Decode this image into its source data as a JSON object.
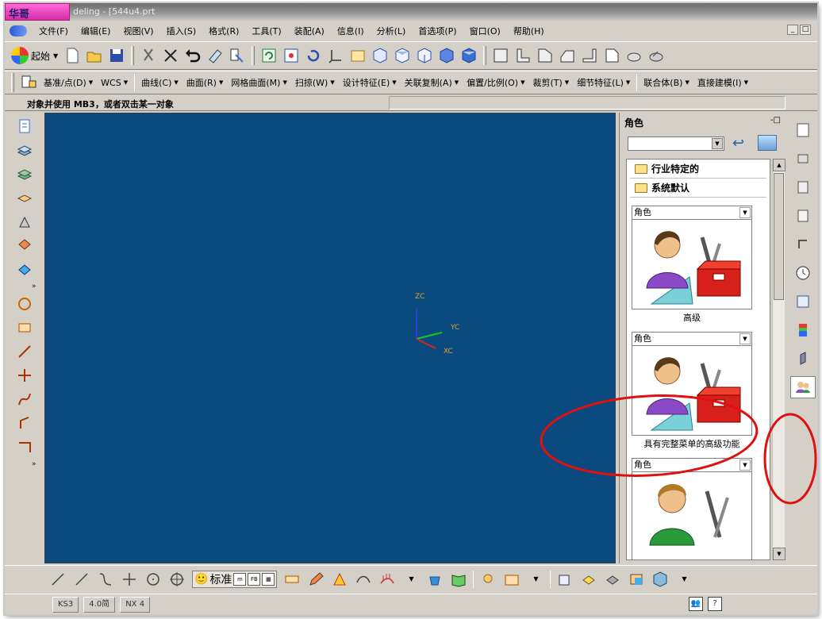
{
  "window": {
    "badge": "华哥",
    "title": "deling - [544u4.prt"
  },
  "menu": [
    "文件(F)",
    "编辑(E)",
    "视图(V)",
    "插入(S)",
    "格式(R)",
    "工具(T)",
    "装配(A)",
    "信息(I)",
    "分析(L)",
    "首选项(P)",
    "窗口(O)",
    "帮助(H)"
  ],
  "toolbar1": {
    "start_label": "起始",
    "icons": [
      "new-file-icon",
      "open-folder-icon",
      "save-icon",
      "cut-icon",
      "delete-icon",
      "undo-icon",
      "eraser-icon",
      "info-icon",
      "refresh-icon",
      "fit-icon",
      "rotate-icon",
      "wcs-icon",
      "shaded-icon",
      "isometric-view-icon",
      "top-view-icon",
      "front-view-icon",
      "right-view-icon",
      "shaded-box-icon",
      "face-select-icon",
      "l-select-icon",
      "plane-select-icon",
      "slope-select-icon",
      "step-select-icon",
      "sheet-select-icon",
      "part-nav-icon",
      "assembly-nav-icon"
    ]
  },
  "toolbar2": {
    "menus": [
      "基准/点(D)",
      "WCS",
      "曲线(C)",
      "曲面(R)",
      "网格曲面(M)",
      "扫掠(W)",
      "设计特征(E)",
      "关联复制(A)",
      "偏置/比例(O)",
      "裁剪(T)",
      "细节特征(L)",
      "联合体(B)",
      "直接建模(I)"
    ]
  },
  "status": {
    "message": "对象并使用 MB3，或者双击某一对象"
  },
  "viewport": {
    "bg": "#0b4a7e",
    "axes": {
      "zc": "ZC",
      "yc": "YC",
      "xc": "XC"
    }
  },
  "role_panel": {
    "title": "角色",
    "pin": "-□",
    "folders": [
      "行业特定的",
      "系统默认"
    ],
    "roles": [
      {
        "header": "角色",
        "caption": "高级"
      },
      {
        "header": "角色",
        "caption": "具有完整菜单的高级功能"
      },
      {
        "header": "角色",
        "caption": ""
      }
    ]
  },
  "bottom_toolbar": {
    "std_label": "标准",
    "mini_labels": [
      "m",
      "FB"
    ]
  },
  "taskbar": {
    "items": [
      "KS3",
      "4.0简",
      "NX 4"
    ],
    "tray": [
      "?"
    ]
  },
  "callout_color": "#e01010"
}
